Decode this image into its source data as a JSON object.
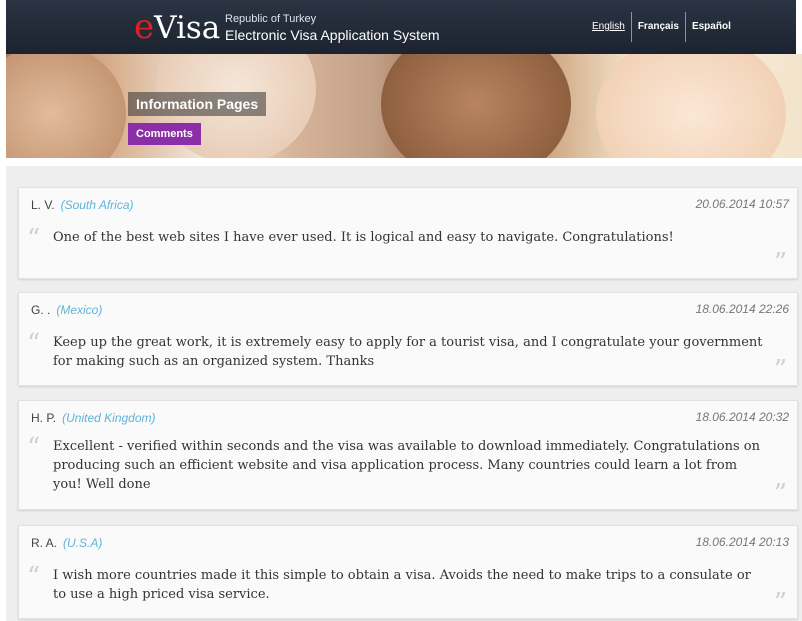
{
  "header": {
    "logo_e": "e",
    "logo_visa": "Visa",
    "republic": "Republic of Turkey",
    "system_name": "Electronic Visa Application System",
    "languages": [
      "English",
      "Français",
      "Español"
    ]
  },
  "banner": {
    "info_label": "Information Pages",
    "comments_label": "Comments"
  },
  "comments": [
    {
      "name": "L. V.",
      "country": "(South Africa)",
      "date": "20.06.2014 10:57",
      "text": "One of the best web sites I have ever used. It is logical and easy to navigate. Congratulations!"
    },
    {
      "name": "G. .",
      "country": "(Mexico)",
      "date": "18.06.2014 22:26",
      "text": "Keep up the great work, it is extremely easy to apply for a tourist visa, and I congratulate your government for making such as an organized system. Thanks"
    },
    {
      "name": "H. P.",
      "country": "(United Kingdom)",
      "date": "18.06.2014 20:32",
      "text": "Excellent - verified within seconds and the visa was available to download immediately. Congratulations on producing such an efficient website and visa application process. Many countries could learn a lot from you! Well done"
    },
    {
      "name": "R. A.",
      "country": "(U.S.A)",
      "date": "18.06.2014 20:13",
      "text": "I wish more countries made it this simple to obtain a visa. Avoids the need to make trips to a consulate or to use a high priced visa service."
    }
  ],
  "icons": {
    "open_quote": "“",
    "close_quote": "”"
  },
  "colors": {
    "accent_purple": "#8b2fa8",
    "country_blue": "#5fb3d8",
    "logo_red": "#e02020"
  }
}
